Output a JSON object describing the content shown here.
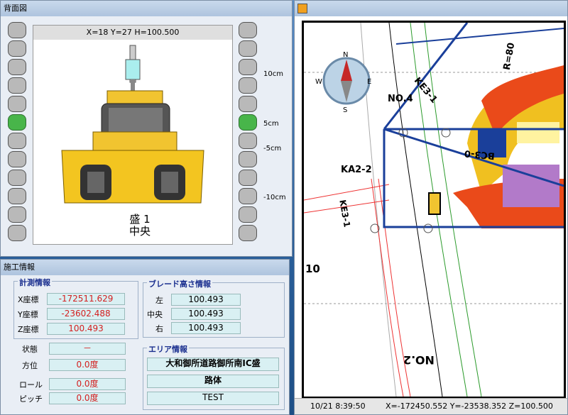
{
  "blade_window": {
    "title": "背面図",
    "coords": "X=18 Y=27 H=100.500",
    "mode_line1": "盛 1",
    "mode_line2": "中央",
    "scale": [
      "10cm",
      "5cm",
      "-5cm",
      "-10cm"
    ]
  },
  "info_window": {
    "title": "施工情報",
    "measure": {
      "title": "計測情報",
      "x_label": "X座標",
      "x_value": "-172511.629",
      "y_label": "Y座標",
      "y_value": "-23602.488",
      "z_label": "Z座標",
      "z_value": "100.493"
    },
    "status": {
      "state_label": "状態",
      "state_value": "－",
      "heading_label": "方位",
      "heading_value": "0.0度",
      "roll_label": "ロール",
      "roll_value": "0.0度",
      "pitch_label": "ピッチ",
      "pitch_value": "0.0度"
    },
    "blade_height": {
      "title": "ブレード高さ情報",
      "left_label": "左",
      "left_value": "100.493",
      "center_label": "中央",
      "center_value": "100.493",
      "right_label": "右",
      "right_value": "100.493"
    },
    "area": {
      "title": "エリア情報",
      "line1": "大和御所道路御所南IC盛",
      "line2": "路体",
      "line3": "TEST"
    }
  },
  "map_window": {
    "compass": {
      "n": "N",
      "s": "S",
      "e": "E",
      "w": "W"
    },
    "labels": {
      "no4": "NO.4",
      "ke31": "KE3-1",
      "bc30": "BC3-0",
      "ka2": "KA2-2",
      "r80": "R=80",
      "no2": "NO.2",
      "ke31b": "KE3-1",
      "ten": "10"
    },
    "status": {
      "datetime": "10/21 8:39:50",
      "coords": "X=-172450.552 Y=-23538.352 Z=100.500"
    }
  },
  "colors": {
    "led_on": "#48b54a",
    "led_off": "#b9b9b9",
    "value_red": "#d42020",
    "title_blue": "#1a2f8f"
  }
}
